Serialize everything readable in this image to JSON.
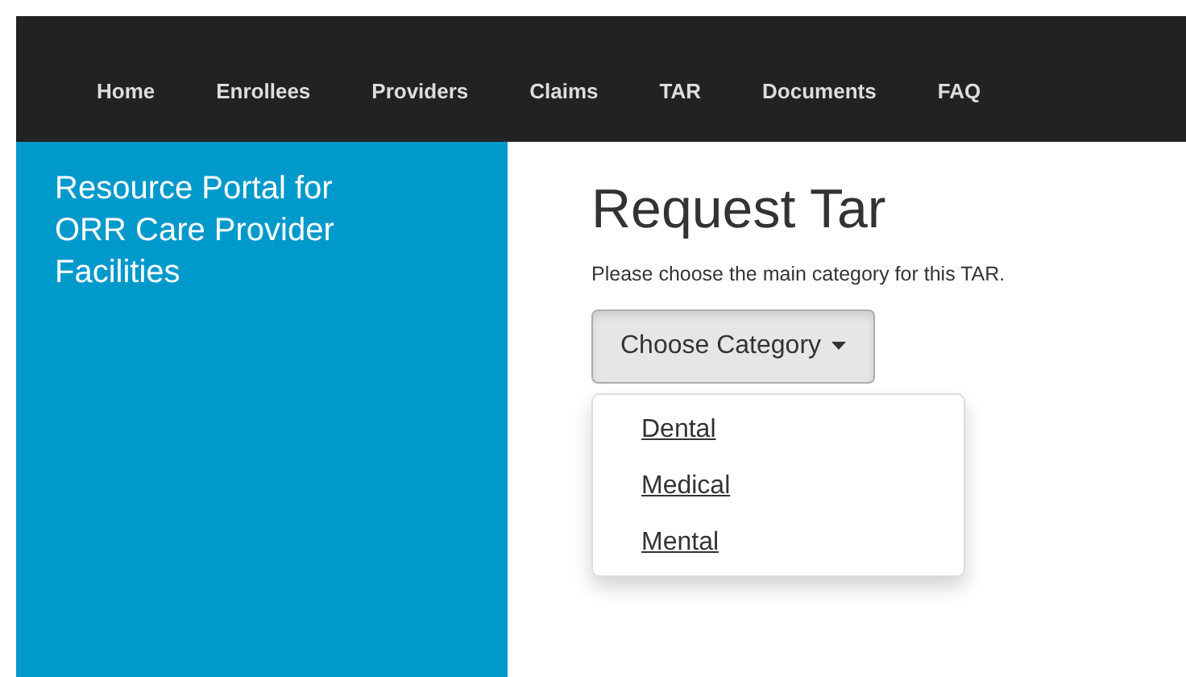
{
  "navbar": {
    "items": [
      {
        "label": "Home"
      },
      {
        "label": "Enrollees"
      },
      {
        "label": "Providers"
      },
      {
        "label": "Claims"
      },
      {
        "label": "TAR"
      },
      {
        "label": "Documents"
      },
      {
        "label": "FAQ"
      }
    ]
  },
  "sidebar": {
    "title": "Resource Portal for ORR Care Provider Facilities"
  },
  "main": {
    "heading": "Request Tar",
    "instruction": "Please choose the main category for this TAR.",
    "dropdown": {
      "label": "Choose Category",
      "expanded": true,
      "options": [
        {
          "label": "Dental"
        },
        {
          "label": "Medical"
        },
        {
          "label": "Mental"
        }
      ]
    }
  }
}
